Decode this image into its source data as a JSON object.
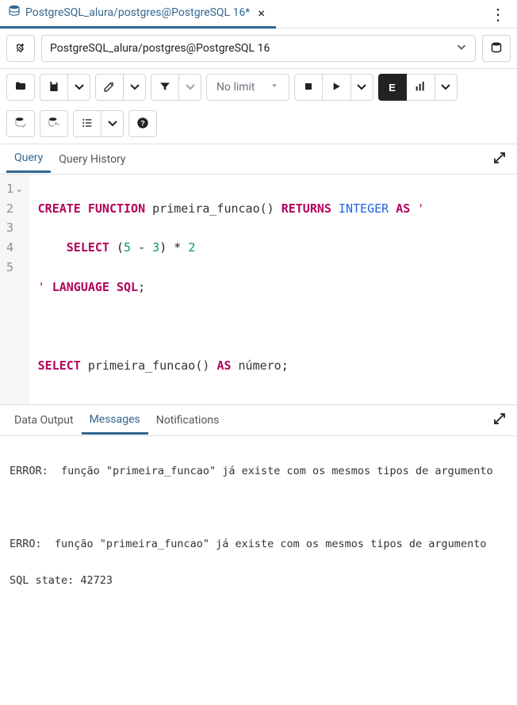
{
  "tab": {
    "title": "PostgreSQL_alura/postgres@PostgreSQL 16*"
  },
  "connection": {
    "label": "PostgreSQL_alura/postgres@PostgreSQL 16"
  },
  "toolbar": {
    "limit_label": "No limit",
    "explain_label": "E"
  },
  "query_tabs": {
    "query": "Query",
    "history": "Query History"
  },
  "editor": {
    "lines": [
      "1",
      "2",
      "3",
      "4",
      "5"
    ],
    "l1_create": "CREATE",
    "l1_function": "FUNCTION",
    "l1_name": " primeira_funcao() ",
    "l1_returns": "RETURNS",
    "l1_type": "INTEGER",
    "l1_as": "AS",
    "l1_q": " '",
    "l2_indent": "    ",
    "l2_select": "SELECT",
    "l2_expr_open": " (",
    "l2_num5": "5",
    "l2_minus": " - ",
    "l2_num3": "3",
    "l2_expr_close": ") * ",
    "l2_num2": "2",
    "l3_q": "'",
    "l3_lang": " LANGUAGE",
    "l3_sql": " SQL",
    "l3_semi": ";",
    "l5_select": "SELECT",
    "l5_call": " primeira_funcao() ",
    "l5_as": "AS",
    "l5_alias": " número",
    "l5_semi": ";"
  },
  "output_tabs": {
    "data": "Data Output",
    "messages": "Messages",
    "notifications": "Notifications"
  },
  "messages": {
    "line1": "ERROR:  função \"primeira_funcao\" já existe com os mesmos tipos de argumento",
    "blank": " ",
    "line2": "ERRO:  função \"primeira_funcao\" já existe com os mesmos tipos de argumento",
    "line3": "SQL state: 42723"
  }
}
